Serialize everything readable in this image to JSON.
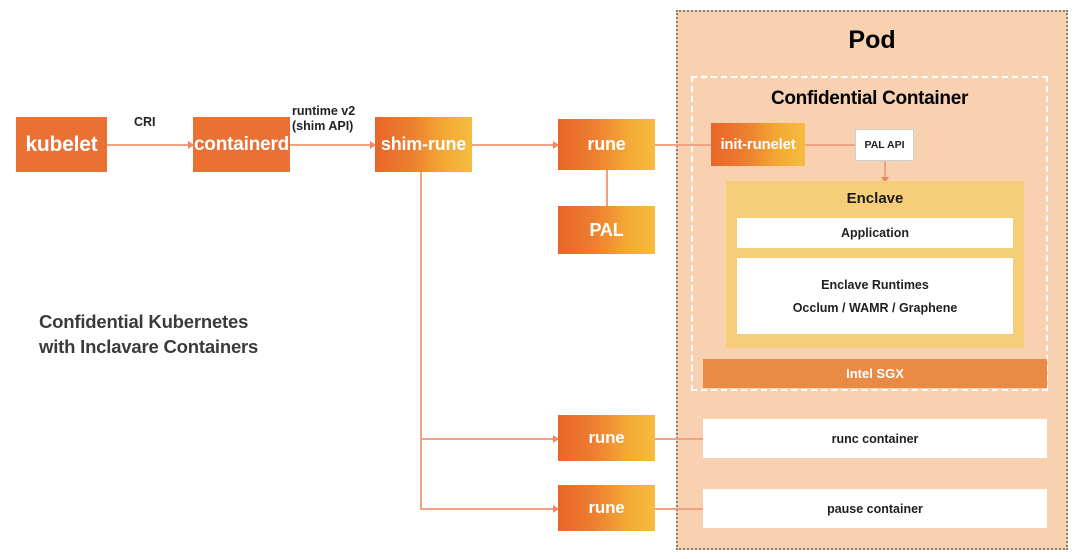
{
  "diagram": {
    "caption": "Confidential Kubernetes\nwith Inclavare Containers",
    "colors": {
      "node_gradient_start": "#E8652A",
      "node_gradient_end": "#F6BC3F",
      "node_flat": "#EA7034",
      "pod_background": "#F8D2B0",
      "pod_border": "#8A7F70",
      "enclave_background": "#F6CE79",
      "sgx_background": "#E98B44",
      "connector": "#F3A183",
      "white_box": "#FFFFFF",
      "caption_text": "#3B3B3B"
    },
    "nodes": {
      "kubelet": "kubelet",
      "containerd": "containerd",
      "shim_rune": "shim-rune",
      "rune_top": "rune",
      "pal": "PAL",
      "rune_middle": "rune",
      "rune_bottom": "rune",
      "init_runelet": "init-runelet"
    },
    "edge_labels": {
      "cri": "CRI",
      "runtime_v2": "runtime v2\n(shim API)"
    },
    "pod": {
      "title": "Pod",
      "confidential_container": {
        "title": "Confidential Container",
        "pal_api": "PAL API",
        "enclave": {
          "title": "Enclave",
          "application": "Application",
          "runtimes_title": "Enclave Runtimes",
          "runtimes_list": "Occlum / WAMR / Graphene"
        },
        "hardware": "Intel SGX"
      },
      "containers": [
        "runc container",
        "pause container"
      ]
    }
  }
}
